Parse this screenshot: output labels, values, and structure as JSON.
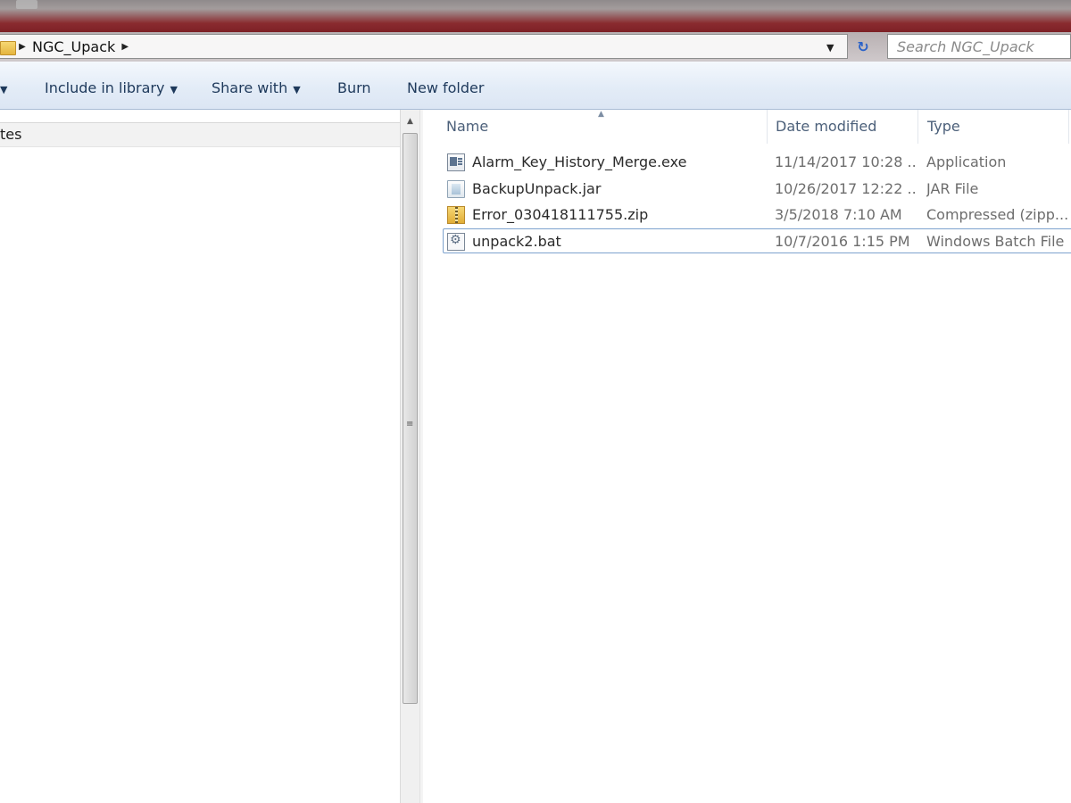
{
  "address": {
    "breadcrumb": [
      "NGC_Upack"
    ],
    "search_placeholder": "Search NGC_Upack"
  },
  "toolbar": {
    "include_in_library": "Include in library",
    "share_with": "Share with",
    "burn": "Burn",
    "new_folder": "New folder"
  },
  "nav": {
    "favorites_label": "tes"
  },
  "columns": {
    "name": "Name",
    "date_modified": "Date modified",
    "type": "Type"
  },
  "files": [
    {
      "name": "Alarm_Key_History_Merge.exe",
      "date": "11/14/2017 10:28 ...",
      "type": "Application",
      "icon": "exe-icon"
    },
    {
      "name": "BackupUnpack.jar",
      "date": "10/26/2017 12:22 ...",
      "type": "JAR File",
      "icon": "jar-icon"
    },
    {
      "name": "Error_030418111755.zip",
      "date": "3/5/2018 7:10 AM",
      "type": "Compressed (zipp...",
      "icon": "zip-icon"
    },
    {
      "name": "unpack2.bat",
      "date": "10/7/2016 1:15 PM",
      "type": "Windows Batch File",
      "icon": "bat-icon"
    }
  ],
  "selected_index": 3
}
